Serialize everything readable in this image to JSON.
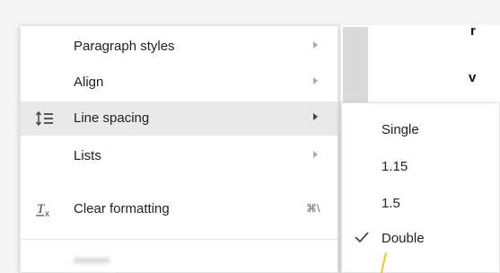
{
  "menu": {
    "items": [
      {
        "label": "Paragraph styles",
        "has_submenu": true
      },
      {
        "label": "Align",
        "has_submenu": true
      },
      {
        "label": "Line spacing",
        "has_submenu": true,
        "icon": "line-spacing-icon",
        "highlighted": true
      },
      {
        "label": "Lists",
        "has_submenu": true
      },
      {
        "label": "Clear formatting",
        "icon": "clear-formatting-icon",
        "shortcut": "⌘\\"
      }
    ]
  },
  "submenu": {
    "items": [
      {
        "label": "Single",
        "checked": false
      },
      {
        "label": "1.15",
        "checked": false
      },
      {
        "label": "1.5",
        "checked": false
      },
      {
        "label": "Double",
        "checked": true
      }
    ]
  },
  "document": {
    "fragments": [
      "r",
      "v"
    ]
  },
  "colors": {
    "highlight": "#e9e9e9",
    "callout": "#f4c430"
  }
}
